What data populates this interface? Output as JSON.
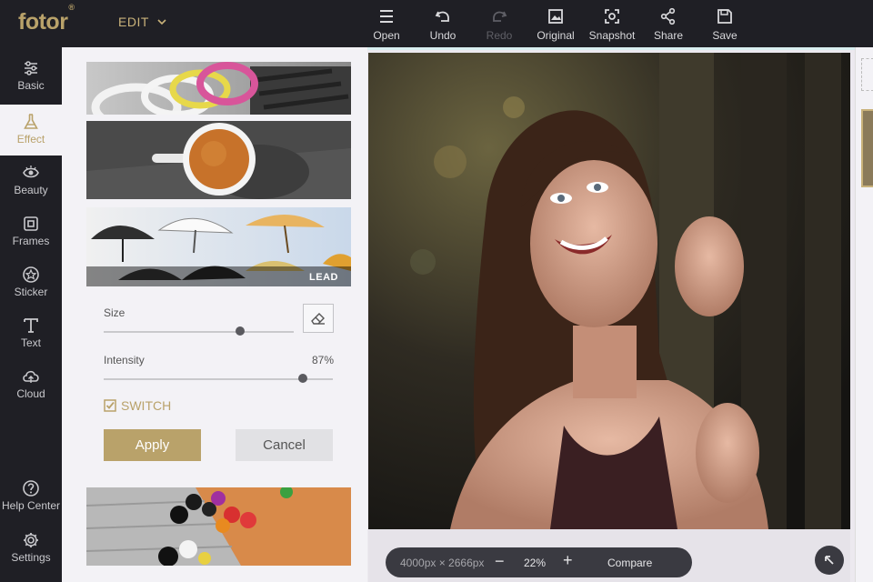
{
  "app": {
    "logo": "fotor",
    "logo_mark": "®",
    "mode_menu": "EDIT"
  },
  "toolbar": {
    "items": [
      {
        "label": "Open",
        "icon": "menu-icon",
        "enabled": true
      },
      {
        "label": "Undo",
        "icon": "undo-icon",
        "enabled": true
      },
      {
        "label": "Redo",
        "icon": "redo-icon",
        "enabled": false
      },
      {
        "label": "Original",
        "icon": "image-icon",
        "enabled": true
      },
      {
        "label": "Snapshot",
        "icon": "snapshot-icon",
        "enabled": true
      },
      {
        "label": "Share",
        "icon": "share-icon",
        "enabled": true
      },
      {
        "label": "Save",
        "icon": "save-icon",
        "enabled": true
      }
    ]
  },
  "sidebar": {
    "items": [
      {
        "label": "Basic",
        "icon": "sliders-icon"
      },
      {
        "label": "Effect",
        "icon": "flask-icon",
        "active": true
      },
      {
        "label": "Beauty",
        "icon": "eye-icon"
      },
      {
        "label": "Frames",
        "icon": "frame-icon"
      },
      {
        "label": "Sticker",
        "icon": "star-icon"
      },
      {
        "label": "Text",
        "icon": "text-icon"
      },
      {
        "label": "Cloud",
        "icon": "cloud-icon"
      }
    ],
    "bottom": [
      {
        "label": "Help Center",
        "icon": "help-icon"
      },
      {
        "label": "Settings",
        "icon": "gear-icon"
      }
    ]
  },
  "effect_panel": {
    "thumbnails": [
      {
        "label": ""
      },
      {
        "label": ""
      },
      {
        "label": "LEAD"
      }
    ],
    "size_label": "Size",
    "size_level": 0.72,
    "intensity_label": "Intensity",
    "intensity_value": "87%",
    "intensity_level": 0.87,
    "switch_label": "SWITCH",
    "switch_checked": true,
    "apply_label": "Apply",
    "cancel_label": "Cancel"
  },
  "canvas": {
    "dimensions": "4000px × 2666px",
    "minus": "−",
    "zoom": "22%",
    "plus": "+",
    "compare_label": "Compare"
  },
  "colors": {
    "accent": "#b9a26a",
    "topbar": "#1f1f25",
    "panel": "#f3f2f6"
  }
}
